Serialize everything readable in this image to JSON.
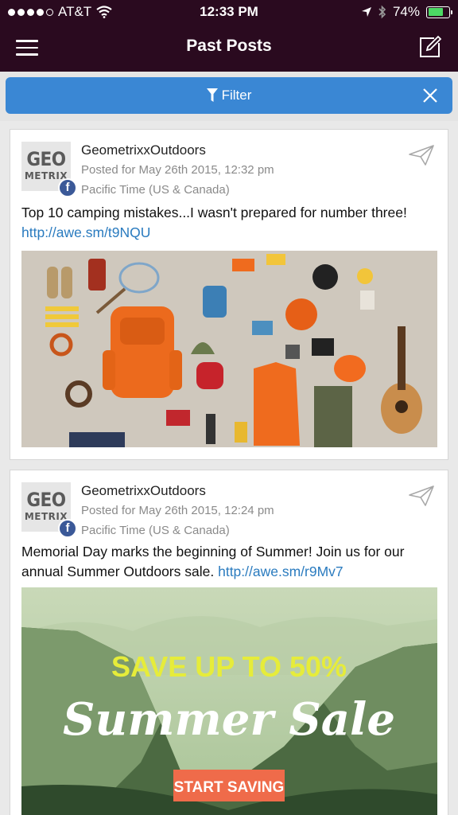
{
  "status_bar": {
    "carrier": "AT&T",
    "time": "12:33 PM",
    "battery": "74%",
    "battery_level": 0.74
  },
  "header": {
    "title": "Past Posts"
  },
  "filter": {
    "label": "Filter"
  },
  "posts": [
    {
      "account": "GeometrixxOutdoors",
      "posted_for": "Posted for May 26th 2015, 12:32 pm",
      "timezone": "Pacific Time (US & Canada)",
      "text": "Top 10 camping mistakes...I wasn't prepared for number three!",
      "link": "http://awe.sm/t9NQU"
    },
    {
      "account": "GeometrixxOutdoors",
      "posted_for": "Posted for May 26th 2015, 12:24 pm",
      "timezone": "Pacific Time (US & Canada)",
      "text": "Memorial Day marks the beginning of Summer! Join us for our annual Summer Outdoors sale.",
      "link": "http://awe.sm/r9Mv7",
      "banner": {
        "headline": "SAVE UP TO 50%",
        "title": "Summer Sale",
        "cta": "START SAVING"
      }
    }
  ],
  "logo": {
    "top": "GEO",
    "bottom": "METRIX"
  },
  "colors": {
    "nav_bg": "#2a0a1f",
    "filter_bg": "#3a87d4",
    "link": "#2a7bbf",
    "facebook": "#3b5998"
  },
  "icons": {
    "menu": "hamburger-icon",
    "compose": "compose-icon",
    "filter": "funnel-icon",
    "close": "close-icon",
    "send": "paper-plane-icon",
    "network": "facebook-icon"
  }
}
